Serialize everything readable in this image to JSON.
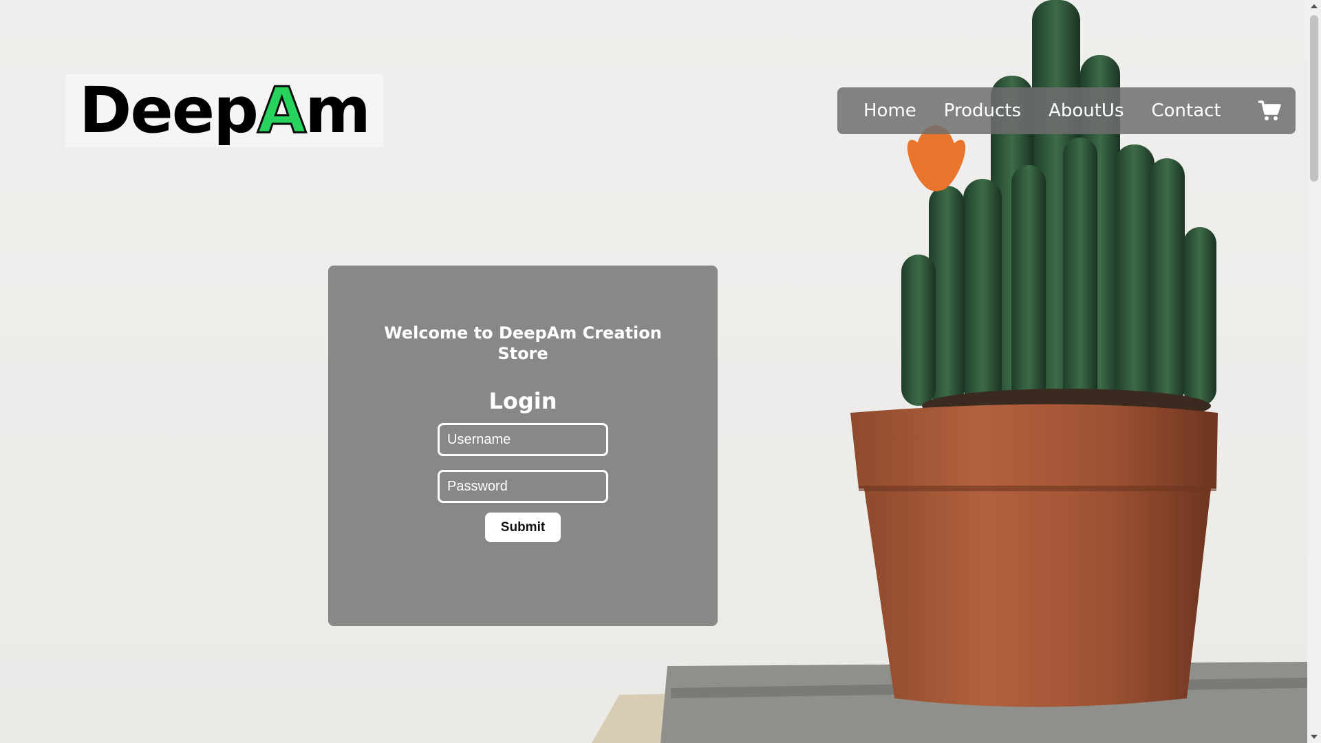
{
  "logo": {
    "part1": "Deep",
    "part2": "A",
    "part3": "m",
    "accent_color": "#27d35c"
  },
  "nav": {
    "items": [
      {
        "label": "Home"
      },
      {
        "label": "Products"
      },
      {
        "label": "AboutUs"
      },
      {
        "label": "Contact"
      }
    ],
    "cart_icon": "shopping-cart-icon"
  },
  "login": {
    "welcome": "Welcome to DeepAm Creation Store",
    "title": "Login",
    "username_placeholder": "Username",
    "password_placeholder": "Password",
    "submit_label": "Submit"
  },
  "colors": {
    "card_background": "#888887",
    "nav_background": "#6e6e6e",
    "page_background": "#efeeec"
  }
}
